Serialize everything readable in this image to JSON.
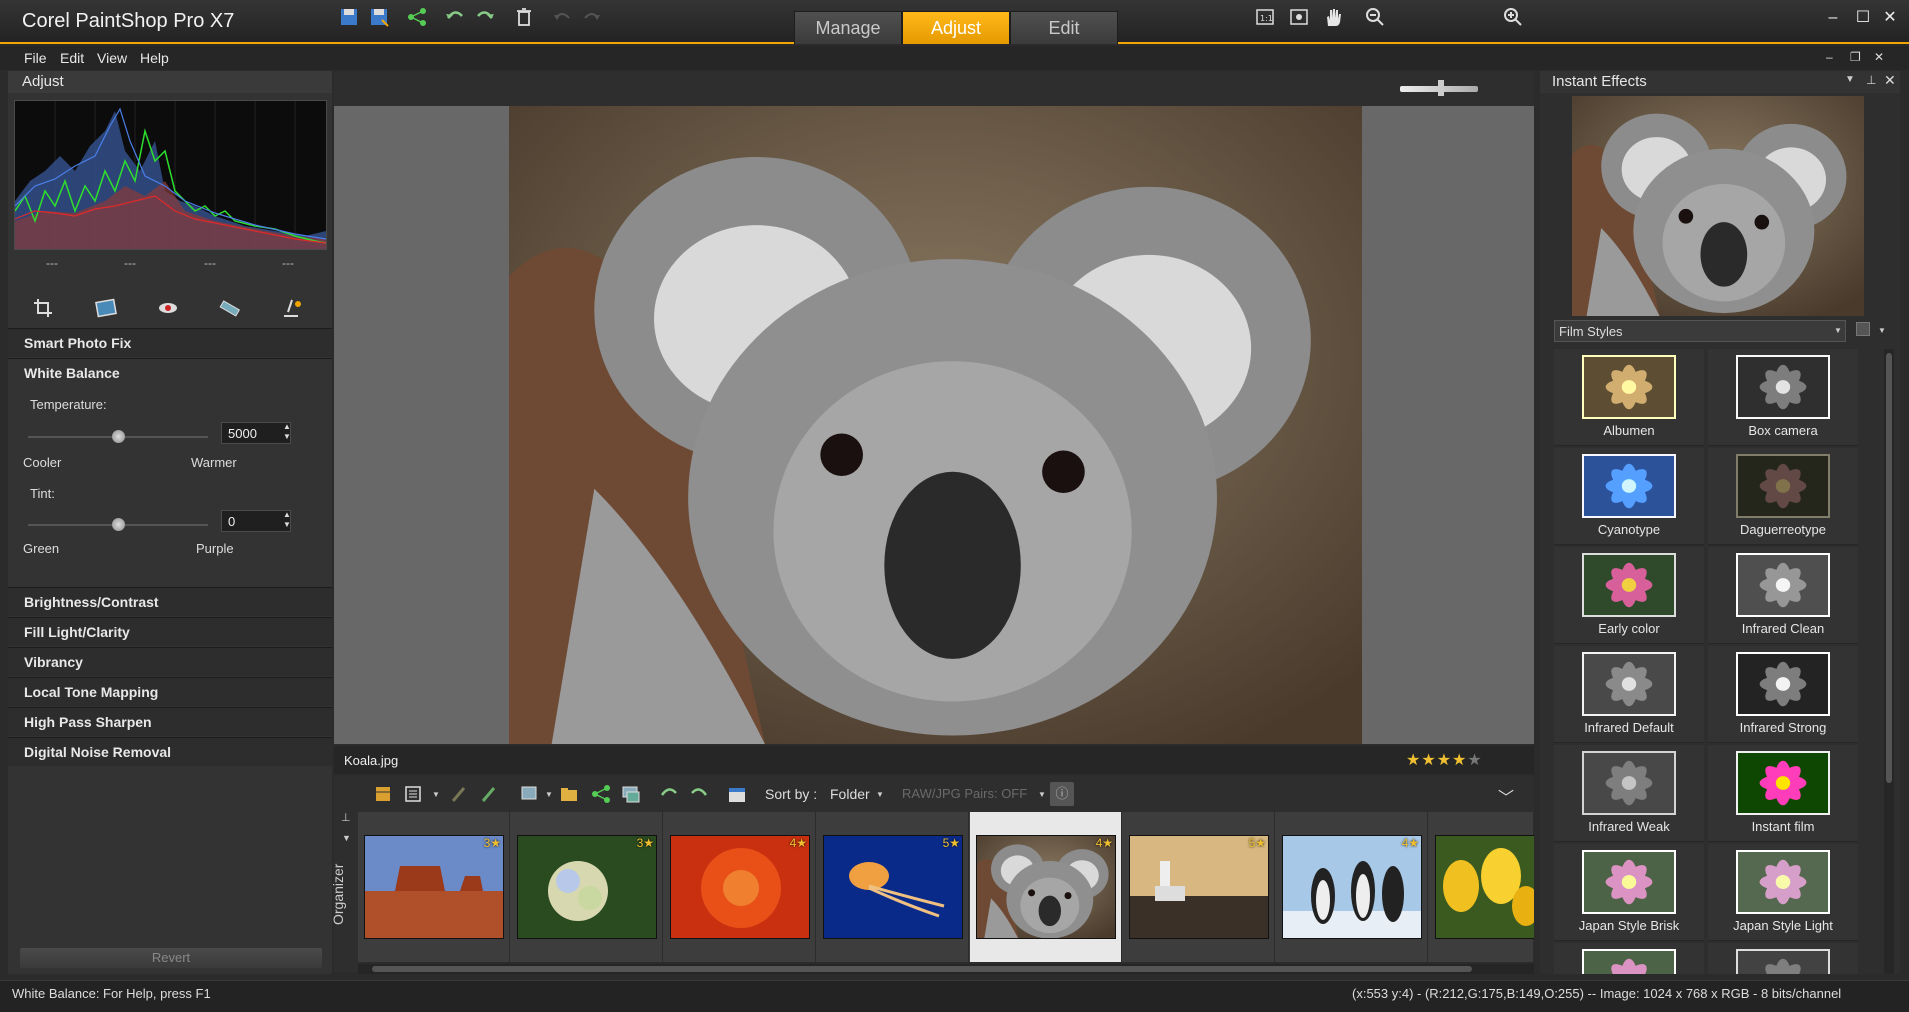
{
  "app": {
    "title": "Corel PaintShop Pro X7"
  },
  "mode_tabs": [
    {
      "label": "Manage"
    },
    {
      "label": "Adjust",
      "active": true
    },
    {
      "label": "Edit"
    }
  ],
  "menu": {
    "items": [
      "File",
      "Edit",
      "View",
      "Help"
    ]
  },
  "left_panel": {
    "title": "Adjust",
    "histogram_readouts": [
      "---",
      "---",
      "---",
      "---"
    ],
    "sections": {
      "smart_photo_fix": "Smart Photo Fix",
      "white_balance": "White Balance",
      "brightness_contrast": "Brightness/Contrast",
      "fill_light_clarity": "Fill Light/Clarity",
      "vibrancy": "Vibrancy",
      "local_tone_mapping": "Local Tone Mapping",
      "high_pass_sharpen": "High Pass Sharpen",
      "digital_noise_removal": "Digital Noise Removal"
    },
    "white_balance": {
      "temperature_label": "Temperature:",
      "temperature_value": "5000",
      "temperature_left": "Cooler",
      "temperature_right": "Warmer",
      "tint_label": "Tint:",
      "tint_value": "0",
      "tint_left": "Green",
      "tint_right": "Purple"
    },
    "revert_label": "Revert"
  },
  "file_bar": {
    "filename": "Koala.jpg",
    "rating": 4
  },
  "organizer": {
    "label": "Organizer",
    "sort_by_label": "Sort by :",
    "sort_by_value": "Folder",
    "raw_jpg": "RAW/JPG Pairs: OFF",
    "thumbnails": [
      {
        "name": "desert",
        "rating": "3"
      },
      {
        "name": "hydrangeas",
        "rating": "3"
      },
      {
        "name": "chrysanthemum",
        "rating": "4"
      },
      {
        "name": "jellyfish",
        "rating": "5"
      },
      {
        "name": "koala",
        "rating": "4",
        "selected": true
      },
      {
        "name": "lighthouse",
        "rating": "5"
      },
      {
        "name": "penguins",
        "rating": "4"
      },
      {
        "name": "tulips",
        "rating": ""
      }
    ]
  },
  "right_panel": {
    "title": "Instant Effects",
    "category": "Film Styles",
    "effects": [
      "Albumen",
      "Box camera",
      "Cyanotype",
      "Daguerreotype",
      "Early color",
      "Infrared Clean",
      "Infrared Default",
      "Infrared Strong",
      "Infrared Weak",
      "Instant film",
      "Japan Style Brisk",
      "Japan Style Light"
    ]
  },
  "status": {
    "left": "White Balance: For Help, press F1",
    "right": "(x:553 y:4) - (R:212,G:175,B:149,O:255) -- Image:  1024 x 768 x RGB - 8 bits/channel"
  },
  "colors": {
    "accent": "#f0a500",
    "star": "#f0c030"
  }
}
